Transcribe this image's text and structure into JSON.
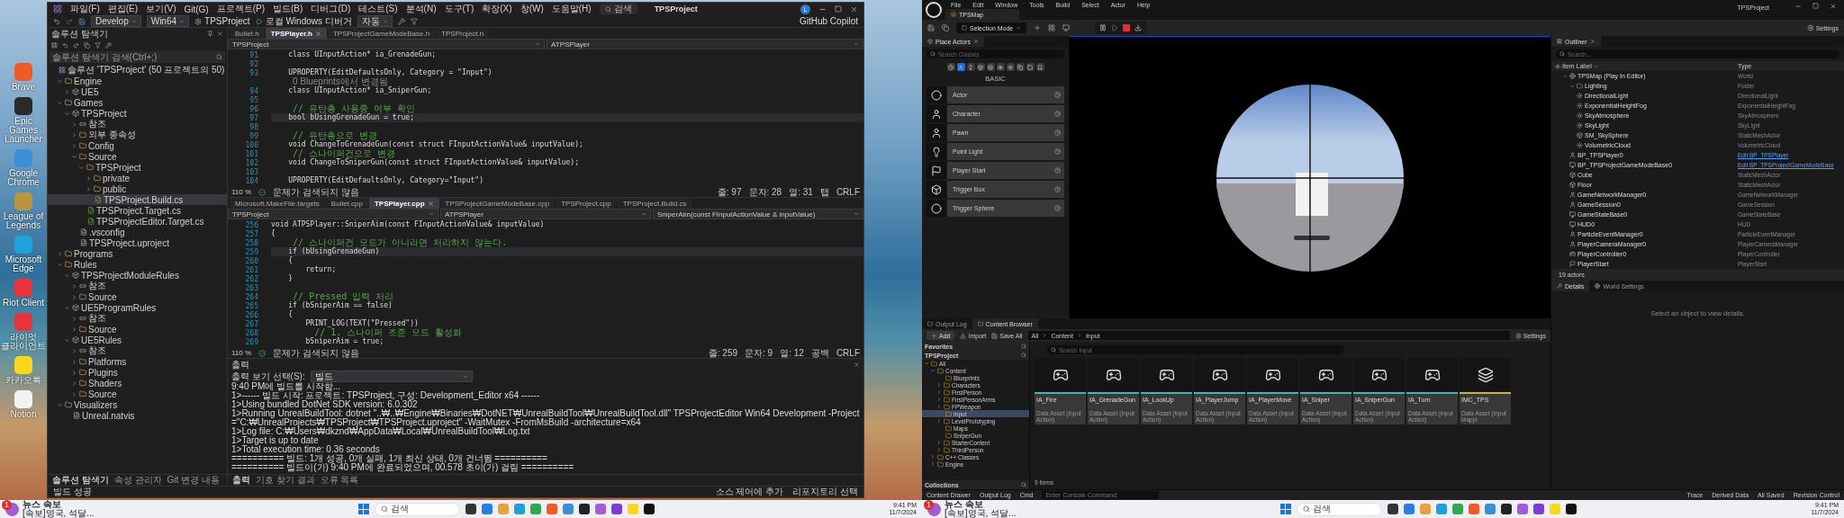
{
  "desktop": {
    "icons": [
      {
        "label": "Brave",
        "color": "#f05a28"
      },
      {
        "label": "Epic Games Launcher",
        "color": "#2a2a2a"
      },
      {
        "label": "Google Chrome",
        "color": "#3b8ed8"
      },
      {
        "label": "League of Legends",
        "color": "#b8963e"
      },
      {
        "label": "Microsoft Edge",
        "color": "#1fa3d8"
      },
      {
        "label": "Riot Client",
        "color": "#e8333c"
      },
      {
        "label": "라이엇 클라이언트",
        "color": "#e8333c"
      },
      {
        "label": "카카오톡",
        "color": "#f9d71c"
      },
      {
        "label": "Notion",
        "color": "#f2f2f2"
      }
    ]
  },
  "vs": {
    "menu": [
      "파일(F)",
      "편집(E)",
      "보기(V)",
      "Git(G)",
      "프로젝트(P)",
      "빌드(B)",
      "디버그(D)",
      "테스트(S)",
      "분석(N)",
      "도구(T)",
      "확장(X)",
      "창(W)",
      "도움말(H)"
    ],
    "search": "검색",
    "title": "TPSProject",
    "account": "L",
    "toolbar": {
      "config": "Develop",
      "platform": "Win64",
      "project": "TPSProject",
      "debugger": "로컬 Windows 디버거",
      "mode": "자동",
      "copilot": "GitHub Copilot"
    },
    "explorer": {
      "title": "솔루션 탐색기",
      "search": "솔루션 탐색기 검색(Ctrl+;)",
      "tree": [
        {
          "label": "솔루션 'TPSProject' (50 프로젝트의 50)",
          "kind": "solution",
          "selected": false,
          "children": [
            {
              "label": "Engine",
              "kind": "folder",
              "selected": false,
              "expanded": true,
              "children": [
                {
                  "label": "UE5",
                  "kind": "project",
                  "selected": false,
                  "expanded": false
                }
              ]
            },
            {
              "label": "Games",
              "kind": "folder",
              "selected": false,
              "expanded": true,
              "children": [
                {
                  "label": "TPSProject",
                  "kind": "project",
                  "selected": false,
                  "expanded": true,
                  "children": [
                    {
                      "label": "참조",
                      "kind": "references",
                      "selected": false,
                      "expanded": false
                    },
                    {
                      "label": "외부 종속성",
                      "kind": "folder",
                      "selected": false,
                      "expanded": false
                    },
                    {
                      "label": "Config",
                      "kind": "folder",
                      "selected": false,
                      "expanded": false
                    },
                    {
                      "label": "Source",
                      "kind": "folder",
                      "selected": false,
                      "expanded": true,
                      "children": [
                        {
                          "label": "TPSProject",
                          "kind": "folder",
                          "selected": false,
                          "expanded": true,
                          "children": [
                            {
                              "label": "private",
                              "kind": "folder",
                              "selected": false,
                              "expanded": false
                            },
                            {
                              "label": "public",
                              "kind": "folder",
                              "selected": false,
                              "expanded": false
                            },
                            {
                              "label": "TPSProject.Build.cs",
                              "kind": "code",
                              "selected": true
                            }
                          ]
                        },
                        {
                          "label": "TPSProject.Target.cs",
                          "kind": "code",
                          "selected": false
                        },
                        {
                          "label": "TPSProjectEditor.Target.cs",
                          "kind": "code",
                          "selected": false
                        }
                      ]
                    },
                    {
                      "label": ".vsconfig",
                      "kind": "file",
                      "selected": false
                    },
                    {
                      "label": "TPSProject.uproject",
                      "kind": "file",
                      "selected": false
                    }
                  ]
                }
              ]
            },
            {
              "label": "Programs",
              "kind": "folder",
              "selected": false,
              "expanded": false
            },
            {
              "label": "Rules",
              "kind": "folder",
              "selected": false,
              "expanded": true,
              "children": [
                {
                  "label": "TPSProjectModuleRules",
                  "kind": "project",
                  "selected": false,
                  "expanded": true,
                  "children": [
                    {
                      "label": "참조",
                      "kind": "references",
                      "selected": false,
                      "expanded": false
                    },
                    {
                      "label": "Source",
                      "kind": "folder",
                      "selected": false,
                      "expanded": false
                    }
                  ]
                },
                {
                  "label": "UE5ProgramRules",
                  "kind": "project",
                  "selected": false,
                  "expanded": true,
                  "children": [
                    {
                      "label": "참조",
                      "kind": "references",
                      "selected": false,
                      "expanded": false
                    },
                    {
                      "label": "Source",
                      "kind": "folder",
                      "selected": false,
                      "expanded": false
                    }
                  ]
                },
                {
                  "label": "UE5Rules",
                  "kind": "project",
                  "selected": false,
                  "expanded": true,
                  "children": [
                    {
                      "label": "참조",
                      "kind": "references",
                      "selected": false,
                      "expanded": false
                    },
                    {
                      "label": "Platforms",
                      "kind": "folder",
                      "selected": false,
                      "expanded": false
                    },
                    {
                      "label": "Plugins",
                      "kind": "folder",
                      "selected": false,
                      "expanded": false
                    },
                    {
                      "label": "Shaders",
                      "kind": "folder",
                      "selected": false,
                      "expanded": false
                    },
                    {
                      "label": "Source",
                      "kind": "folder",
                      "selected": false,
                      "expanded": false
                    }
                  ]
                }
              ]
            },
            {
              "label": "Visualizers",
              "kind": "folder",
              "selected": false,
              "expanded": true,
              "children": [
                {
                  "label": "Unreal.natvis",
                  "kind": "file",
                  "selected": false
                }
              ]
            }
          ]
        }
      ],
      "tabs": [
        {
          "label": "솔루션 탐색기",
          "selected": true
        },
        {
          "label": "속성 관리자",
          "selected": false
        },
        {
          "label": "Git 변경 내용",
          "selected": false
        }
      ]
    },
    "editors": [
      {
        "tabs": [
          {
            "label": "Bullet.h",
            "selected": false
          },
          {
            "label": "TPSPlayer.h",
            "selected": true
          },
          {
            "label": "TPSProjectGameModeBase.h",
            "selected": false
          },
          {
            "label": "TPSProject.h",
            "selected": false
          }
        ],
        "nav": [
          "TPSProject",
          "ATPSPlayer"
        ],
        "lines": [
          {
            "no": "91",
            "kind": "code",
            "text": "    class UInputAction* ia_GrenadeGun;",
            "current": false
          },
          {
            "no": "92",
            "kind": "code",
            "current": false
          },
          {
            "no": "93",
            "kind": "code",
            "text": "    UPROPERTY(EditDefaultsOnly, Category = \"Input\")",
            "current": false
          },
          {
            "kind": "lens",
            "text": "0 Blueprints에서 변경됨"
          },
          {
            "no": "94",
            "kind": "code",
            "text": "    class UInputAction* ia_SniperGun;",
            "current": false
          },
          {
            "no": "95",
            "kind": "code",
            "current": false
          },
          {
            "no": "96",
            "kind": "comment",
            "text": "    // 유탄총 사용중 여부 확인",
            "current": false
          },
          {
            "no": "97",
            "kind": "code",
            "text": "    bool bUsingGrenadeGun = true;",
            "current": true
          },
          {
            "no": "98",
            "kind": "code",
            "current": false
          },
          {
            "no": "99",
            "kind": "comment",
            "text": "    // 유탄총으로 변경",
            "current": false
          },
          {
            "no": "100",
            "kind": "code",
            "text": "    void ChangeToGrenadeGun(const struct FInputActionValue& inputValue);",
            "current": false
          },
          {
            "no": "101",
            "kind": "comment",
            "text": "    // 스나이퍼건으로 변경",
            "current": false
          },
          {
            "no": "102",
            "kind": "code",
            "text": "    void ChangeToSniperGun(const struct FInputActionValue& inputValue);",
            "current": false
          },
          {
            "no": "103",
            "kind": "code",
            "current": false
          },
          {
            "no": "104",
            "kind": "code",
            "text": "    UPROPERTY(EditDefaultsOnly, Category=\"Input\")",
            "current": false
          }
        ],
        "zoom": "110 %",
        "issues": "문제가 검색되지 않음",
        "status": [
          "줄: 97",
          "문자: 28",
          "열: 31",
          "탭",
          "CRLF"
        ]
      },
      {
        "tabs": [
          {
            "label": "Microsoft.MakeFile.targets",
            "selected": false
          },
          {
            "label": "Bullet.cpp",
            "selected": false
          },
          {
            "label": "TPSPlayer.cpp",
            "selected": true
          },
          {
            "label": "TPSProjectGameModeBase.cpp",
            "selected": false
          },
          {
            "label": "TPSProject.cpp",
            "selected": false
          },
          {
            "label": "TPSProject.Build.cs",
            "selected": false
          }
        ],
        "nav": [
          "TPSProject",
          "ATPSPlayer",
          "SniperAim(const FInputActionValue & inputValue)"
        ],
        "lines": [
          {
            "no": "256",
            "kind": "code",
            "text": "void ATPSPlayer::SniperAim(const FInputActionValue& inputValue)",
            "current": false
          },
          {
            "no": "257",
            "kind": "code",
            "text": "{",
            "current": false
          },
          {
            "no": "258",
            "kind": "comment",
            "text": "    // 스나이퍼건 모드가 아니라면 처리하지 않는다.",
            "current": false
          },
          {
            "no": "259",
            "kind": "code",
            "text": "    if (bUsingGrenadeGun)",
            "current": true
          },
          {
            "no": "260",
            "kind": "code",
            "text": "    {",
            "current": false
          },
          {
            "no": "261",
            "kind": "code",
            "text": "        return;",
            "current": false
          },
          {
            "no": "262",
            "kind": "code",
            "text": "    }",
            "current": false
          },
          {
            "no": "263",
            "kind": "code",
            "current": false
          },
          {
            "no": "264",
            "kind": "comment",
            "text": "    // Pressed 입력 처리",
            "current": false
          },
          {
            "no": "265",
            "kind": "code",
            "text": "    if (bSniperAim == false)",
            "current": false
          },
          {
            "no": "266",
            "kind": "code",
            "text": "    {",
            "current": false
          },
          {
            "no": "267",
            "kind": "code",
            "text": "        PRINT_LOG(TEXT(\"Pressed\"))",
            "current": false
          },
          {
            "no": "268",
            "kind": "comment",
            "text": "        // 1. 스나이퍼 조준 모드 활성화",
            "current": false
          },
          {
            "no": "269",
            "kind": "code",
            "text": "        bSniperAim = true;",
            "current": false
          }
        ],
        "zoom": "110 %",
        "issues": "문제가 검색되지 않음",
        "status": [
          "줄: 259",
          "문자: 9",
          "열: 12",
          "공백",
          "CRLF"
        ]
      }
    ],
    "output": {
      "title": "출력",
      "label": "출력 보기 선택(S):",
      "source": "빌드",
      "lines": [
        "9:40 PM에 빌드를 시작함...",
        "1>------ 빌드 시작: 프로젝트: TPSProject, 구성: Development_Editor x64 ------",
        "1>Using bundled DotNet SDK version: 6.0.302",
        "1>Running UnrealBuildTool: dotnet \"..₩..₩Engine₩Binaries₩DotNET₩UnrealBuildTool₩UnrealBuildTool.dll\" TPSProjectEditor Win64 Development -Project=\"C:₩UnrealProjects₩TPSProject₩TPSProject.uproject\" -WaitMutex -FromMsBuild -architecture=x64",
        "1>Log file: C:₩Users₩dkznd₩AppData₩Local₩UnrealBuildTool₩Log.txt",
        "1>Target is up to date",
        "1>Total execution time: 0.36 seconds",
        "========== 빌드: 1개 성공, 0개 실패, 1개 최신 상태, 0개 건너뜀 ==========",
        "========== 빌드이(가) 9:40 PM에 완료되었으며, 00.578 초이(가) 걸림 =========="
      ],
      "tabs": [
        {
          "label": "출력",
          "selected": true
        },
        {
          "label": "기호 찾기 결과",
          "selected": false
        },
        {
          "label": "오류 목록",
          "selected": false
        }
      ]
    },
    "status_bar": {
      "message": "빌드 성공",
      "items": [
        "소스 제어에 추가",
        "리포지토리 선택"
      ]
    }
  },
  "ue": {
    "menu": [
      "File",
      "Edit",
      "Window",
      "Tools",
      "Build",
      "Select",
      "Actor",
      "Help"
    ],
    "level_tab": "TPSMap",
    "project": "TPSProject",
    "toolbar": {
      "mode": "Selection Mode",
      "settings": "Settings"
    },
    "place_actors": {
      "title": "Place Actors",
      "search": "Search Classes",
      "filters": [
        {
          "selected": false
        },
        {
          "selected": true
        },
        {
          "selected": false
        },
        {
          "selected": false
        },
        {
          "selected": false
        },
        {
          "selected": false
        },
        {
          "selected": false
        },
        {
          "selected": false
        },
        {
          "selected": false
        },
        {
          "selected": false
        }
      ],
      "category": "BASIC",
      "items": [
        "Actor",
        "Character",
        "Pawn",
        "Point Light",
        "Player Start",
        "Trigger Box",
        "Trigger Sphere"
      ]
    },
    "outliner": {
      "title": "Outliner",
      "search": "Search...",
      "columns": [
        "Item Label",
        "Type"
      ],
      "rows": [
        {
          "label": "TPSMap (Play In Editor)",
          "type": "World",
          "kind": "world",
          "link": false,
          "expanded": true,
          "children": [
            {
              "label": "Lighting",
              "type": "Folder",
              "kind": "folder",
              "link": false,
              "expanded": true,
              "children": [
                {
                  "label": "DirectionalLight",
                  "type": "DirectionalLight",
                  "kind": "light",
                  "link": false
                },
                {
                  "label": "ExponentialHeightFog",
                  "type": "ExponentialHeightFog",
                  "kind": "light",
                  "link": false
                },
                {
                  "label": "SkyAtmosphere",
                  "type": "SkyAtmosphere",
                  "kind": "light",
                  "link": false
                },
                {
                  "label": "SkyLight",
                  "type": "SkyLight",
                  "kind": "light",
                  "link": false
                },
                {
                  "label": "SM_SkySphere",
                  "type": "StaticMeshActor",
                  "kind": "mesh",
                  "link": false
                },
                {
                  "label": "VolumetricCloud",
                  "type": "VolumetricCloud",
                  "kind": "light",
                  "link": false
                }
              ]
            },
            {
              "label": "BP_TPSPlayer0",
              "type": "Edit BP_TPSPlayer",
              "kind": "actor",
              "link": true
            },
            {
              "label": "BP_TPSProjectGameModeBase0",
              "type": "Edit BP_TPSProjectGameModeBase",
              "kind": "hud",
              "link": true
            },
            {
              "label": "Cube",
              "type": "StaticMeshActor",
              "kind": "mesh",
              "link": false
            },
            {
              "label": "Floor",
              "type": "StaticMeshActor",
              "kind": "mesh",
              "link": false
            },
            {
              "label": "GameNetworkManager0",
              "type": "GameNetworkManager",
              "kind": "actor",
              "link": false
            },
            {
              "label": "GameSession0",
              "type": "GameSession",
              "kind": "actor",
              "link": false
            },
            {
              "label": "GameStateBase0",
              "type": "GameStateBase",
              "kind": "hud",
              "link": false
            },
            {
              "label": "HUD0",
              "type": "HUD",
              "kind": "hud",
              "link": false
            },
            {
              "label": "ParticleEventManager0",
              "type": "ParticleEventManager",
              "kind": "actor",
              "link": false
            },
            {
              "label": "PlayerCameraManager0",
              "type": "PlayerCameraManager",
              "kind": "actor",
              "link": false
            },
            {
              "label": "PlayerController0",
              "type": "PlayerController",
              "kind": "controller",
              "link": false
            },
            {
              "label": "PlayerStart",
              "type": "PlayerStart",
              "kind": "start",
              "link": false
            }
          ]
        }
      ],
      "count": "19 actors"
    },
    "details": {
      "tabs": [
        {
          "label": "Details",
          "selected": true
        },
        {
          "label": "World Settings",
          "selected": false
        }
      ],
      "empty": "Select an object to view details."
    },
    "content_browser": {
      "tabs": [
        {
          "label": "Output Log",
          "selected": false
        },
        {
          "label": "Content Browser",
          "selected": true
        }
      ],
      "add": "Add",
      "buttons": [
        "Import",
        "Save All"
      ],
      "path": [
        "All",
        "Content",
        "Input"
      ],
      "settings": "Settings",
      "favorites": "Favorites",
      "project": "TPSProject",
      "folders": [
        {
          "label": "All",
          "selected": false,
          "expanded": true,
          "children": [
            {
              "label": "Content",
              "selected": false,
              "expanded": true,
              "children": [
                {
                  "label": "Blueprints",
                  "selected": false
                },
                {
                  "label": "Characters",
                  "selected": false,
                  "expanded": false
                },
                {
                  "label": "FirstPerson",
                  "selected": false,
                  "expanded": false
                },
                {
                  "label": "FirstPersonArms",
                  "selected": false,
                  "expanded": false
                },
                {
                  "label": "FPWeapon",
                  "selected": false,
                  "expanded": false
                },
                {
                  "label": "Input",
                  "selected": true
                },
                {
                  "label": "LevelPrototyping",
                  "selected": false,
                  "expanded": false
                },
                {
                  "label": "Maps",
                  "selected": false
                },
                {
                  "label": "SniperGun",
                  "selected": false
                },
                {
                  "label": "StarterContent",
                  "selected": false,
                  "expanded": false
                },
                {
                  "label": "ThirdPerson",
                  "selected": false,
                  "expanded": false
                }
              ]
            },
            {
              "label": "C++ Classes",
              "selected": false,
              "expanded": false
            },
            {
              "label": "Engine",
              "selected": false,
              "expanded": false
            }
          ]
        }
      ],
      "collections": "Collections",
      "search": "Search Input",
      "assets": [
        {
          "name": "IA_Fire",
          "type": "Data Asset (Input Action)",
          "kind": "action",
          "color": "#3fb6b2"
        },
        {
          "name": "IA_GrenadeGun",
          "type": "Data Asset (Input Action)",
          "kind": "action",
          "color": "#3fb6b2"
        },
        {
          "name": "IA_LookUp",
          "type": "Data Asset (Input Action)",
          "kind": "action",
          "color": "#3fb6b2"
        },
        {
          "name": "IA_PlayerJump",
          "type": "Data Asset (Input Action)",
          "kind": "action",
          "color": "#3fb6b2"
        },
        {
          "name": "IA_PlayerMove",
          "type": "Data Asset (Input Action)",
          "kind": "action",
          "color": "#3fb6b2"
        },
        {
          "name": "IA_Sniper",
          "type": "Data Asset (Input Action)",
          "kind": "action",
          "color": "#3fb6b2"
        },
        {
          "name": "IA_SniperGun",
          "type": "Data Asset (Input Action)",
          "kind": "action",
          "color": "#3fb6b2"
        },
        {
          "name": "IA_Turn",
          "type": "Data Asset (Input Action)",
          "kind": "action",
          "color": "#3fb6b2"
        },
        {
          "name": "IMC_TPS",
          "type": "Data Asset (Input Mappi",
          "kind": "mapping",
          "color": "#c9b43a"
        }
      ],
      "count": "9 items"
    },
    "status_bar": {
      "left": [
        "Content Drawer",
        "Output Log",
        "Cmd"
      ],
      "console": "Enter Console Command",
      "right": [
        "Trace",
        "Derived Data",
        "All Saved",
        "Revision Control"
      ]
    }
  },
  "taskbars": [
    {
      "badge": "1",
      "news_title": "뉴스 속보",
      "news_text": "[속보]영국, 석달...",
      "search": "검색",
      "time": "9:41 PM",
      "date": "11/7/2024"
    },
    {
      "badge": "1",
      "news_title": "뉴스 속보",
      "news_text": "[속보]영국, 석달...",
      "search": "검색",
      "time": "9:41 PM",
      "date": "11/7/2024"
    }
  ]
}
